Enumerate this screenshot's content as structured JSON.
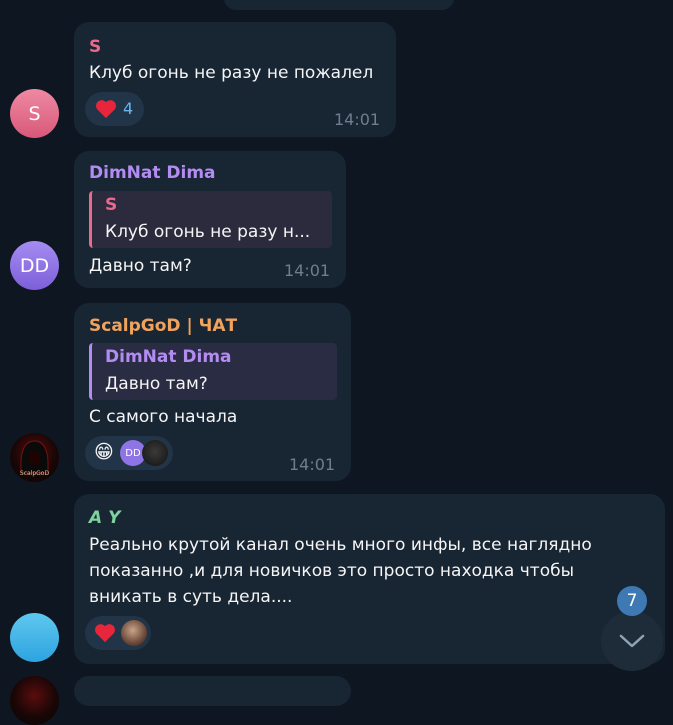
{
  "messages": [
    {
      "author": "S",
      "author_color": "#e86a8f",
      "avatar_initials": "S",
      "text": "Клуб огонь не разу не пожалел",
      "reaction_count": "4",
      "time": "14:01"
    },
    {
      "author": "DimNat Dima",
      "author_color": "#b38cf2",
      "avatar_initials": "DD",
      "quote_author": "S",
      "quote_text": "Клуб огонь не разу н...",
      "text": "Давно там?",
      "time": "14:01"
    },
    {
      "author": "ScalpGoD | ЧАТ",
      "author_color": "#f0a35c",
      "avatar_label": "ScalpGoD",
      "quote_author": "DimNat Dima",
      "quote_text": "Давно там?",
      "text": "С самого начала",
      "reaction_emoji": "😁",
      "reactor_initials": "DD",
      "time": "14:01"
    },
    {
      "author": "𝘼 𝙔",
      "author_color": "#7fd2a0",
      "text_lines": [
        "Реально крутой канал очень много инфы, все наглядно",
        "показанно ,и для новичков это просто находка чтобы",
        "вникать в суть дела...."
      ]
    }
  ],
  "unread_badge": "7",
  "icons": {
    "reaction": "heart-icon",
    "scroll": "chevron-down-icon"
  }
}
